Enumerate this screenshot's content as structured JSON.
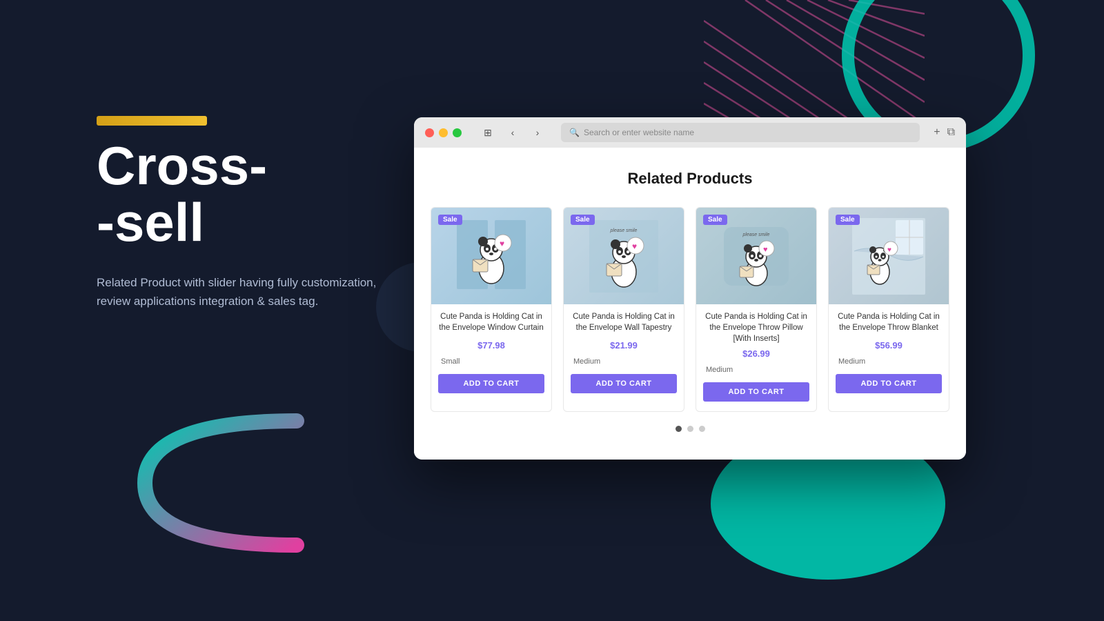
{
  "page": {
    "background_color": "#141b2d"
  },
  "left": {
    "title_line1": "Cross-",
    "title_line2": "-sell",
    "subtitle": "Related Product with slider having fully customization, review applications integration & sales tag."
  },
  "browser": {
    "address_placeholder": "Search or enter website name",
    "section_title": "Related Products",
    "dots": [
      "red",
      "yellow",
      "green"
    ],
    "slider_dots": [
      {
        "active": true
      },
      {
        "active": false
      },
      {
        "active": false
      }
    ]
  },
  "products": [
    {
      "id": 1,
      "badge": "Sale",
      "name": "Cute Panda is Holding Cat in the Envelope Window Curtain",
      "price": "$77.98",
      "variant": "Small",
      "add_to_cart": "ADD TO CART",
      "bg_color": "#b8d4e8"
    },
    {
      "id": 2,
      "badge": "Sale",
      "name": "Cute Panda is Holding Cat in the Envelope Wall Tapestry",
      "price": "$21.99",
      "variant": "Medium",
      "add_to_cart": "ADD TO CART",
      "bg_color": "#c5d8e5"
    },
    {
      "id": 3,
      "badge": "Sale",
      "name": "Cute Panda is Holding Cat in the Envelope Throw Pillow [With Inserts]",
      "price": "$26.99",
      "variant": "Medium",
      "add_to_cart": "ADD TO CART",
      "bg_color": "#b8cfd8"
    },
    {
      "id": 4,
      "badge": "Sale",
      "name": "Cute Panda is Holding Cat in the Envelope Throw Blanket",
      "price": "$56.99",
      "variant": "Medium",
      "add_to_cart": "ADD TO CART",
      "bg_color": "#c8d5e0"
    }
  ]
}
